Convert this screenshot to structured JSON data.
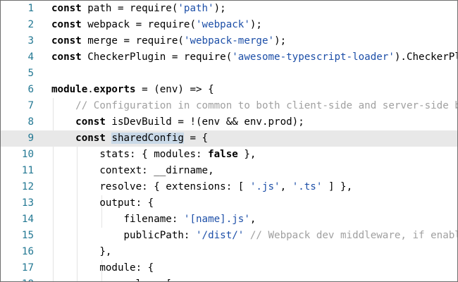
{
  "editor": {
    "lines": [
      {
        "n": "1",
        "parts": [
          {
            "t": "kw",
            "v": "const"
          },
          {
            "t": "",
            "v": " path = require("
          },
          {
            "t": "str",
            "v": "'path'"
          },
          {
            "t": "",
            "v": ");"
          }
        ]
      },
      {
        "n": "2",
        "parts": [
          {
            "t": "kw",
            "v": "const"
          },
          {
            "t": "",
            "v": " webpack = require("
          },
          {
            "t": "str",
            "v": "'webpack'"
          },
          {
            "t": "",
            "v": ");"
          }
        ]
      },
      {
        "n": "3",
        "parts": [
          {
            "t": "kw",
            "v": "const"
          },
          {
            "t": "",
            "v": " merge = require("
          },
          {
            "t": "str",
            "v": "'webpack-merge'"
          },
          {
            "t": "",
            "v": ");"
          }
        ]
      },
      {
        "n": "4",
        "parts": [
          {
            "t": "kw",
            "v": "const"
          },
          {
            "t": "",
            "v": " CheckerPlugin = require("
          },
          {
            "t": "str",
            "v": "'awesome-typescript-loader'"
          },
          {
            "t": "",
            "v": ").CheckerPlugin;"
          }
        ]
      },
      {
        "n": "5",
        "parts": []
      },
      {
        "n": "6",
        "parts": [
          {
            "t": "kw",
            "v": "module"
          },
          {
            "t": "",
            "v": "."
          },
          {
            "t": "kw",
            "v": "exports"
          },
          {
            "t": "",
            "v": " = (env) => {"
          }
        ]
      },
      {
        "n": "7",
        "parts": [
          {
            "t": "",
            "v": "    "
          },
          {
            "t": "cmt",
            "v": "// Configuration in common to both client-side and server-side bundles"
          }
        ]
      },
      {
        "n": "8",
        "parts": [
          {
            "t": "",
            "v": "    "
          },
          {
            "t": "kw",
            "v": "const"
          },
          {
            "t": "",
            "v": " isDevBuild = !(env && env.prod);"
          }
        ]
      },
      {
        "n": "9",
        "parts": [
          {
            "t": "",
            "v": "    "
          },
          {
            "t": "kw",
            "v": "const"
          },
          {
            "t": "",
            "v": " "
          },
          {
            "t": "hl",
            "v": "sharedConfig"
          },
          {
            "t": "",
            "v": " = {"
          }
        ]
      },
      {
        "n": "10",
        "parts": [
          {
            "t": "",
            "v": "        stats: { modules: "
          },
          {
            "t": "kw",
            "v": "false"
          },
          {
            "t": "",
            "v": " },"
          }
        ]
      },
      {
        "n": "11",
        "parts": [
          {
            "t": "",
            "v": "        context: __dirname,"
          }
        ]
      },
      {
        "n": "12",
        "parts": [
          {
            "t": "",
            "v": "        resolve: { extensions: [ "
          },
          {
            "t": "str",
            "v": "'.js'"
          },
          {
            "t": "",
            "v": ", "
          },
          {
            "t": "str",
            "v": "'.ts'"
          },
          {
            "t": "",
            "v": " ] },"
          }
        ]
      },
      {
        "n": "13",
        "parts": [
          {
            "t": "",
            "v": "        output: {"
          }
        ]
      },
      {
        "n": "14",
        "parts": [
          {
            "t": "",
            "v": "            filename: "
          },
          {
            "t": "str",
            "v": "'[name].js'"
          },
          {
            "t": "",
            "v": ","
          }
        ]
      },
      {
        "n": "15",
        "parts": [
          {
            "t": "",
            "v": "            publicPath: "
          },
          {
            "t": "str",
            "v": "'/dist/'"
          },
          {
            "t": "",
            "v": " "
          },
          {
            "t": "cmt",
            "v": "// Webpack dev middleware, if enabled, handles requests for this URL prefix"
          }
        ]
      },
      {
        "n": "16",
        "parts": [
          {
            "t": "",
            "v": "        },"
          }
        ]
      },
      {
        "n": "17",
        "parts": [
          {
            "t": "",
            "v": "        module: {"
          }
        ]
      },
      {
        "n": "18",
        "parts": [
          {
            "t": "",
            "v": "            rules: ["
          }
        ]
      }
    ],
    "current_line": 9
  }
}
